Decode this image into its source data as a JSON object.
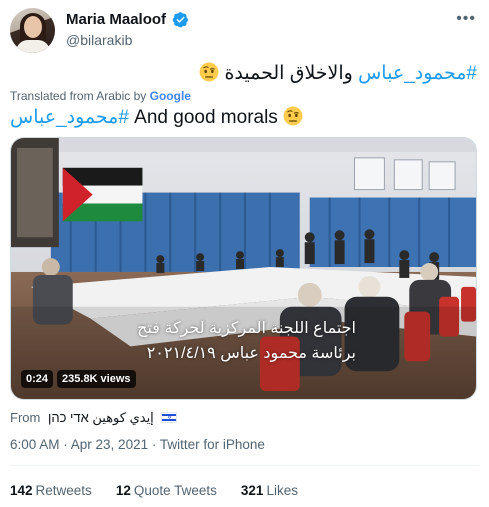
{
  "author": {
    "display_name": "Maria Maaloof",
    "handle": "@bilarakib",
    "verified": true,
    "verified_icon": "verified-badge-icon"
  },
  "more_icon": "ellipsis-icon",
  "tweet": {
    "original_hashtag": "#محمود_عباس",
    "original_text": " والاخلاق الحميدة ",
    "translated_label": "Translated from Arabic by",
    "translated_brand": "Google",
    "translation_hashtag": "#محمود_عباس",
    "translation_text": " And good morals ",
    "emoji": "face-with-raised-eyebrow-icon"
  },
  "video": {
    "caption_line1": "اجتماع اللجنة المركزية لحركة فتح",
    "caption_line2": "برئاسة محمود عباس ٢٠٢١/٤/١٩",
    "duration": "0:24",
    "views": "235.8K views"
  },
  "source": {
    "label": "From",
    "name": "إيدي كوهين אדי כהן",
    "flag_icon": "israel-flag-icon"
  },
  "timestamp": "6:00 AM · Apr 23, 2021 · Twitter for iPhone",
  "stats": {
    "retweets_count": "142",
    "retweets_label": "Retweets",
    "quotes_count": "12",
    "quotes_label": "Quote Tweets",
    "likes_count": "321",
    "likes_label": "Likes"
  },
  "colors": {
    "link_blue": "#1d9bf0",
    "secondary_text": "#536471",
    "primary_text": "#0f1419"
  }
}
